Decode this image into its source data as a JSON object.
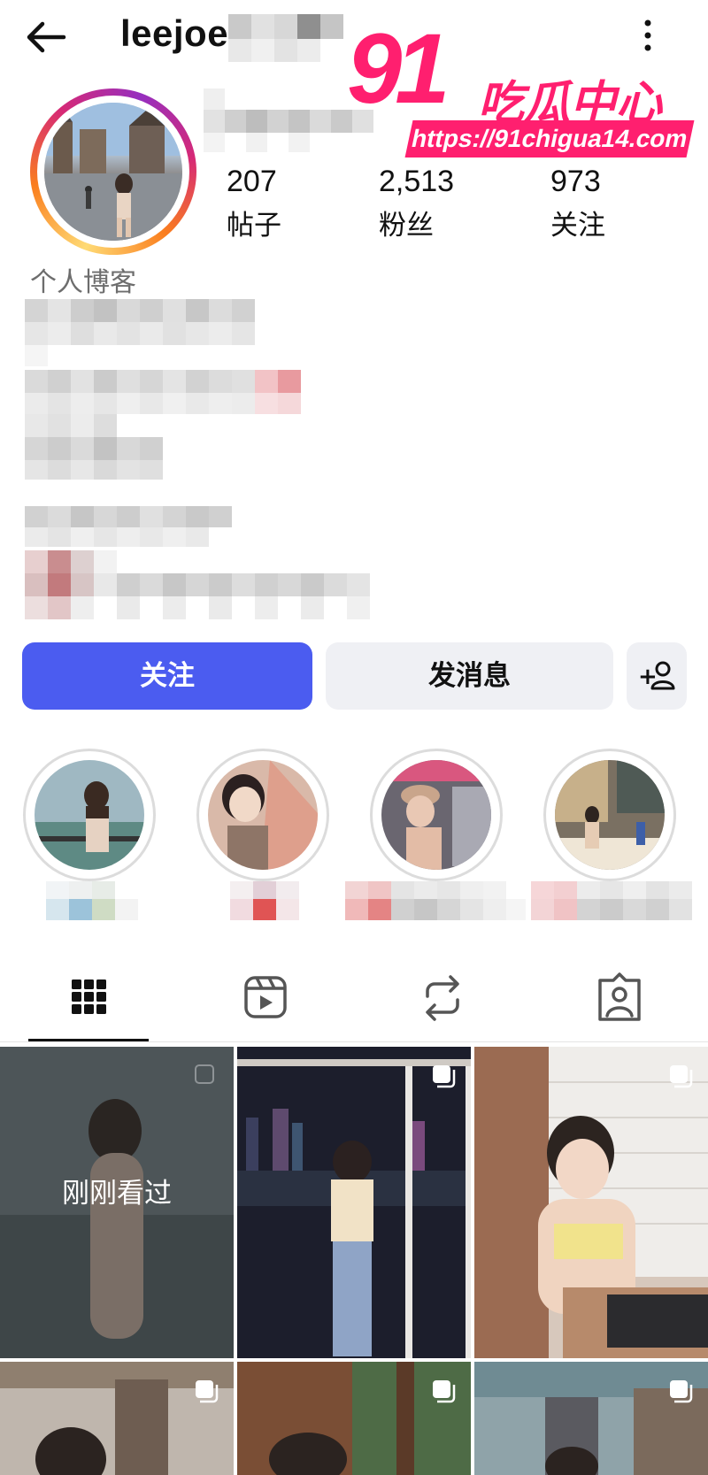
{
  "header": {
    "username": "leejoe",
    "back_icon": "arrow-left-icon",
    "more_icon": "more-vertical-icon"
  },
  "watermark": {
    "number": "91",
    "name": "吃瓜中心",
    "url": "https://91chigua14.com",
    "color": "#ff1f6f"
  },
  "stats": [
    {
      "value": "207",
      "label": "帖子"
    },
    {
      "value": "2,513",
      "label": "粉丝"
    },
    {
      "value": "973",
      "label": "关注"
    }
  ],
  "bio": {
    "category": "个人博客"
  },
  "actions": {
    "follow_label": "关注",
    "message_label": "发消息",
    "add_icon": "add-person-icon",
    "follow_color": "#4b5cf0"
  },
  "tabs": [
    {
      "icon": "grid-icon",
      "active": true
    },
    {
      "icon": "reels-icon",
      "active": false
    },
    {
      "icon": "repost-icon",
      "active": false
    },
    {
      "icon": "tagged-icon",
      "active": false
    }
  ],
  "grid": {
    "viewed_label": "刚刚看过"
  }
}
